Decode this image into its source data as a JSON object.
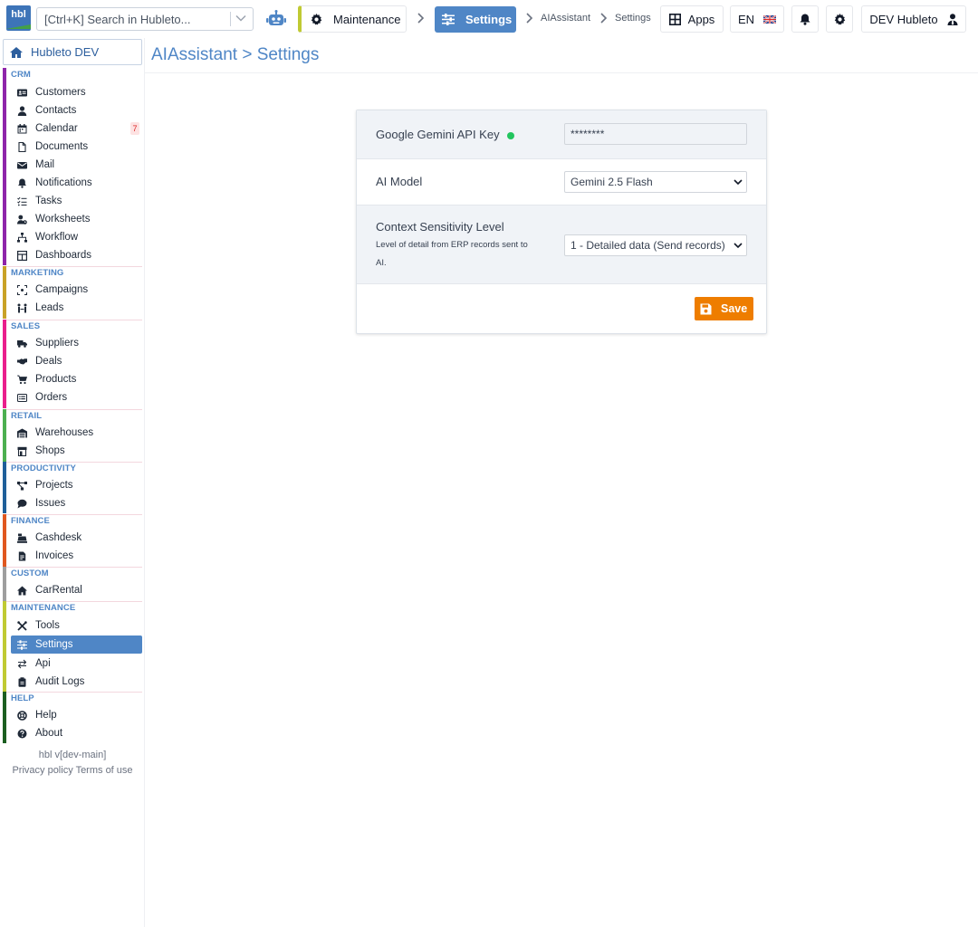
{
  "topbar": {
    "logo_text": "hbl",
    "search_placeholder": "[Ctrl+K] Search in Hubleto...",
    "maintenance_label": "Maintenance",
    "settings_label": "Settings",
    "crumb_1": "AIAssistant",
    "crumb_2": "Settings",
    "apps_label": "Apps",
    "language": "EN",
    "user_label": "DEV Hubleto"
  },
  "sidebar": {
    "home_label": "Hubleto DEV",
    "groups": [
      {
        "title": "CRM",
        "color": "#8e24aa"
      },
      {
        "title": "MARKETING",
        "color": "#c9a227"
      },
      {
        "title": "SALES",
        "color": "#e91e8c"
      },
      {
        "title": "RETAIL",
        "color": "#4caf50"
      },
      {
        "title": "PRODUCTIVITY",
        "color": "#1f5f99"
      },
      {
        "title": "FINANCE",
        "color": "#e0571f"
      },
      {
        "title": "CUSTOM",
        "color": "#9e9e9e"
      },
      {
        "title": "MAINTENANCE",
        "color": "#c0ca33"
      },
      {
        "title": "HELP",
        "color": "#1b5e20"
      }
    ],
    "items": {
      "customers": "Customers",
      "contacts": "Contacts",
      "calendar": "Calendar",
      "calendar_badge": "7",
      "documents": "Documents",
      "mail": "Mail",
      "notifications": "Notifications",
      "tasks": "Tasks",
      "worksheets": "Worksheets",
      "workflow": "Workflow",
      "dashboards": "Dashboards",
      "campaigns": "Campaigns",
      "leads": "Leads",
      "suppliers": "Suppliers",
      "deals": "Deals",
      "products": "Products",
      "orders": "Orders",
      "warehouses": "Warehouses",
      "shops": "Shops",
      "projects": "Projects",
      "issues": "Issues",
      "cashdesk": "Cashdesk",
      "invoices": "Invoices",
      "carrental": "CarRental",
      "tools": "Tools",
      "settings": "Settings",
      "api": "Api",
      "auditlogs": "Audit Logs",
      "help": "Help",
      "about": "About"
    },
    "version": "hbl v[dev-main]",
    "privacy": "Privacy policy",
    "terms": "Terms of use"
  },
  "main": {
    "title": "AIAssistant > Settings",
    "api_key_label": "Google Gemini API Key",
    "api_key_value": "********",
    "model_label": "AI Model",
    "model_value": "Gemini 2.5 Flash",
    "context_label": "Context Sensitivity Level",
    "context_desc": "Level of detail from ERP records sent to AI.",
    "context_value": "1 - Detailed data (Send records)",
    "save_label": "Save",
    "accent_color": "#4f86c6",
    "save_color": "#ee7d00",
    "status_color": "#22c55e"
  }
}
